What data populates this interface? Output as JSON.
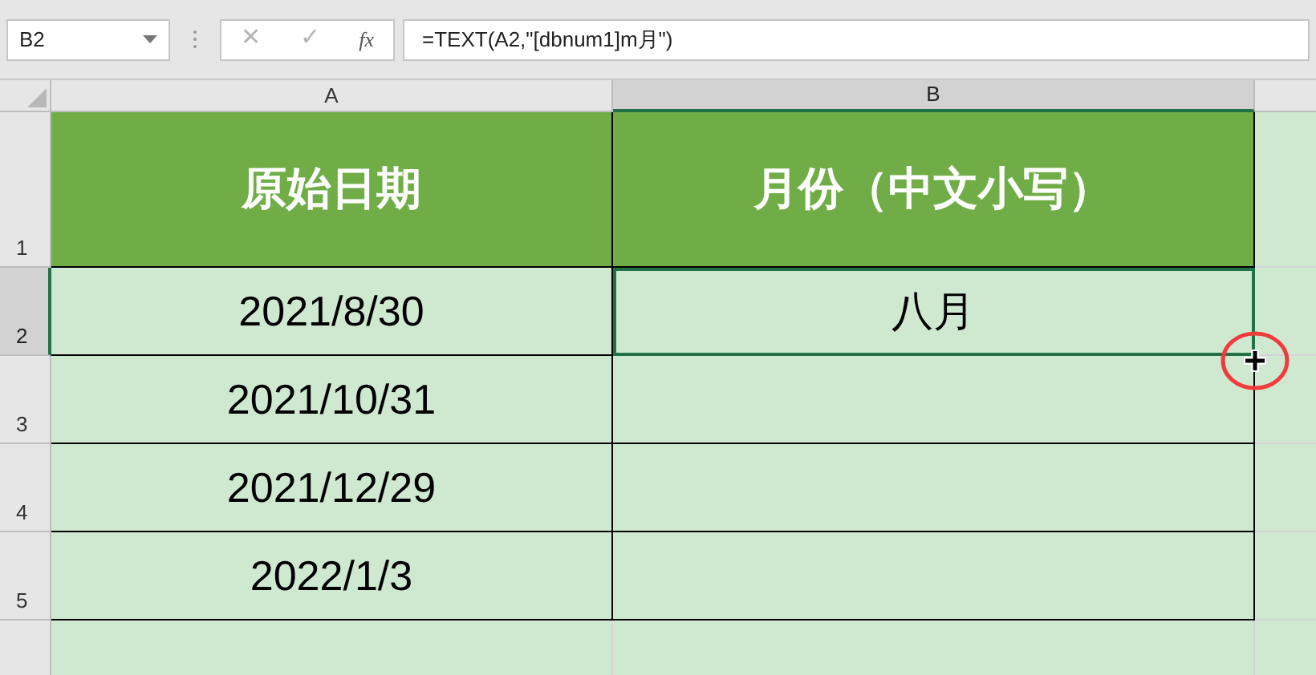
{
  "name_box": {
    "value": "B2"
  },
  "formula_bar": {
    "cancel": "✕",
    "enter": "✓",
    "fx": "fx",
    "formula": "=TEXT(A2,\"[dbnum1]m月\")"
  },
  "columns": [
    {
      "label": "A",
      "selected": false
    },
    {
      "label": "B",
      "selected": true
    }
  ],
  "rows": [
    {
      "number": "1",
      "selected": false,
      "kind": "header",
      "cells": [
        {
          "text": "原始日期",
          "selected": false
        },
        {
          "text": "月份（中文小写）",
          "selected": false
        }
      ]
    },
    {
      "number": "2",
      "selected": true,
      "kind": "data",
      "cells": [
        {
          "text": "2021/8/30",
          "selected": false
        },
        {
          "text": "八月",
          "selected": true
        }
      ]
    },
    {
      "number": "3",
      "selected": false,
      "kind": "data",
      "cells": [
        {
          "text": "2021/10/31",
          "selected": false
        },
        {
          "text": "",
          "selected": false
        }
      ]
    },
    {
      "number": "4",
      "selected": false,
      "kind": "data",
      "cells": [
        {
          "text": "2021/12/29",
          "selected": false
        },
        {
          "text": "",
          "selected": false
        }
      ]
    },
    {
      "number": "5",
      "selected": false,
      "kind": "data",
      "cells": [
        {
          "text": "2022/1/3",
          "selected": false
        },
        {
          "text": "",
          "selected": false
        }
      ]
    }
  ]
}
